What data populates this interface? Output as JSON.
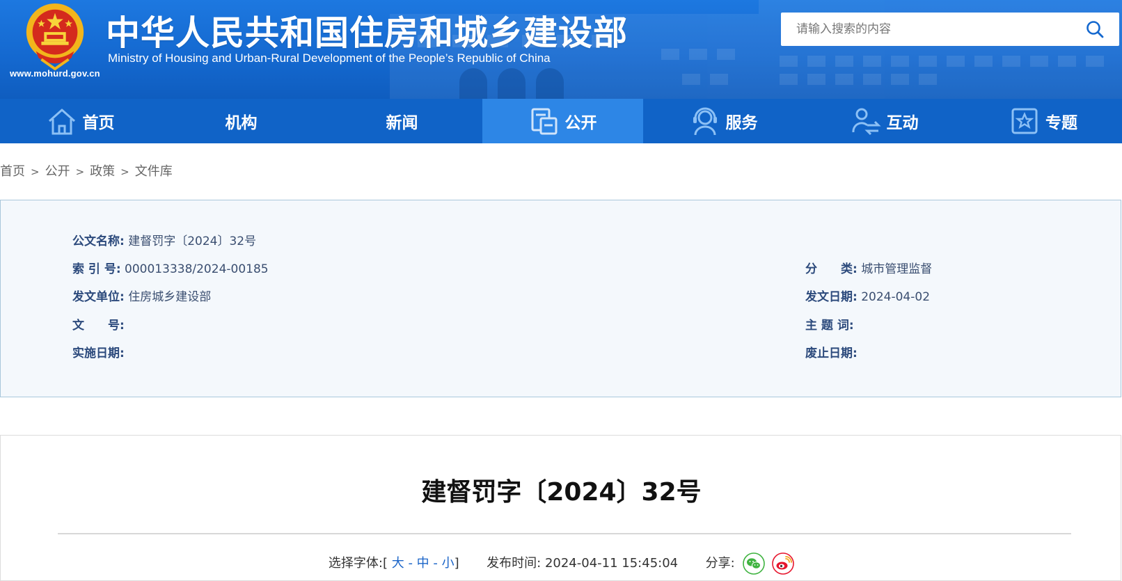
{
  "header": {
    "site_title": "中华人民共和国住房和城乡建设部",
    "site_subtitle": "Ministry of Housing and Urban-Rural Development of the People’s Republic of China",
    "site_url": "www.mohurd.gov.cn",
    "search_placeholder": "请输入搜索的内容",
    "search_icon": "search-icon"
  },
  "nav": {
    "items": [
      {
        "label": "首页",
        "icon": "home-icon"
      },
      {
        "label": "机构",
        "icon": ""
      },
      {
        "label": "新闻",
        "icon": ""
      },
      {
        "label": "公开",
        "icon": "document-icon",
        "active": true
      },
      {
        "label": "服务",
        "icon": "service-agent-icon"
      },
      {
        "label": "互动",
        "icon": "interaction-icon"
      },
      {
        "label": "专题",
        "icon": "star-board-icon"
      }
    ]
  },
  "breadcrumb": {
    "items": [
      "首页",
      "公开",
      "政策",
      "文件库"
    ],
    "separator": ">"
  },
  "meta": {
    "doc_name_label": "公文名称:",
    "doc_name_value": "建督罚字〔2024〕32号",
    "index_label": "索 引 号:",
    "index_value": "000013338/2024-00185",
    "category_label": "分　　类:",
    "category_value": "城市管理监督",
    "issuer_label": "发文单位:",
    "issuer_value": "住房城乡建设部",
    "issue_date_label": "发文日期:",
    "issue_date_value": "2024-04-02",
    "doc_no_label": "文　　号:",
    "doc_no_value": "",
    "keywords_label": "主 题 词:",
    "keywords_value": "",
    "effective_label": "实施日期:",
    "effective_value": "",
    "expiry_label": "废止日期:",
    "expiry_value": ""
  },
  "article": {
    "title": "建督罚字〔2024〕32号",
    "font_select_label": "选择字体:",
    "font_open": "[",
    "font_large": "大",
    "font_medium": "中",
    "font_small": "小",
    "font_close": "]",
    "font_dash": "-",
    "publish_label": "发布时间:",
    "publish_time": "2024-04-11 15:45:04",
    "share_label": "分享:"
  },
  "colors": {
    "header_blue": "#1468cf",
    "nav_blue": "#1063c7",
    "nav_active": "#2d86e6",
    "link_blue": "#1a64c8",
    "wechat_green": "#3fb340",
    "weibo_red": "#e6162d"
  }
}
